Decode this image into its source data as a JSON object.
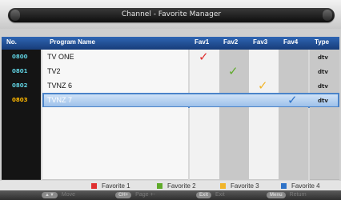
{
  "title": "Channel - Favorite Manager",
  "columns": {
    "no": "No.",
    "name": "Program Name",
    "fav1": "Fav1",
    "fav2": "Fav2",
    "fav3": "Fav3",
    "fav4": "Fav4",
    "type": "Type"
  },
  "channels": [
    {
      "no": "0800",
      "name": "TV ONE",
      "type": "dtv",
      "fav1": "✓",
      "fav2": "",
      "fav3": "",
      "fav4": ""
    },
    {
      "no": "0801",
      "name": "TV2",
      "type": "dtv",
      "fav1": "",
      "fav2": "✓",
      "fav3": "",
      "fav4": ""
    },
    {
      "no": "0802",
      "name": "TVNZ 6",
      "type": "dtv",
      "fav1": "",
      "fav2": "",
      "fav3": "✓",
      "fav4": ""
    },
    {
      "no": "0803",
      "name": "TVNZ 7",
      "type": "dtv",
      "fav1": "",
      "fav2": "",
      "fav3": "",
      "fav4": "✓"
    }
  ],
  "selected_row": 3,
  "legend": [
    {
      "label": "Favorite 1",
      "color": "#e03030"
    },
    {
      "label": "Favorite 2",
      "color": "#5faa2a"
    },
    {
      "label": "Favorite 3",
      "color": "#f1b52a"
    },
    {
      "label": "Favorite 4",
      "color": "#2f73c8"
    }
  ],
  "footer": {
    "move_key": "▲▼",
    "move_label": "Move",
    "page_key": "CH+",
    "page_label": "Page +-",
    "exit_key": "Exit",
    "exit_label": "Exit",
    "menu_key": "Menu",
    "menu_label": "Return"
  },
  "colors": {
    "accent": "#2f66b4",
    "selection": "#4b84c9"
  }
}
